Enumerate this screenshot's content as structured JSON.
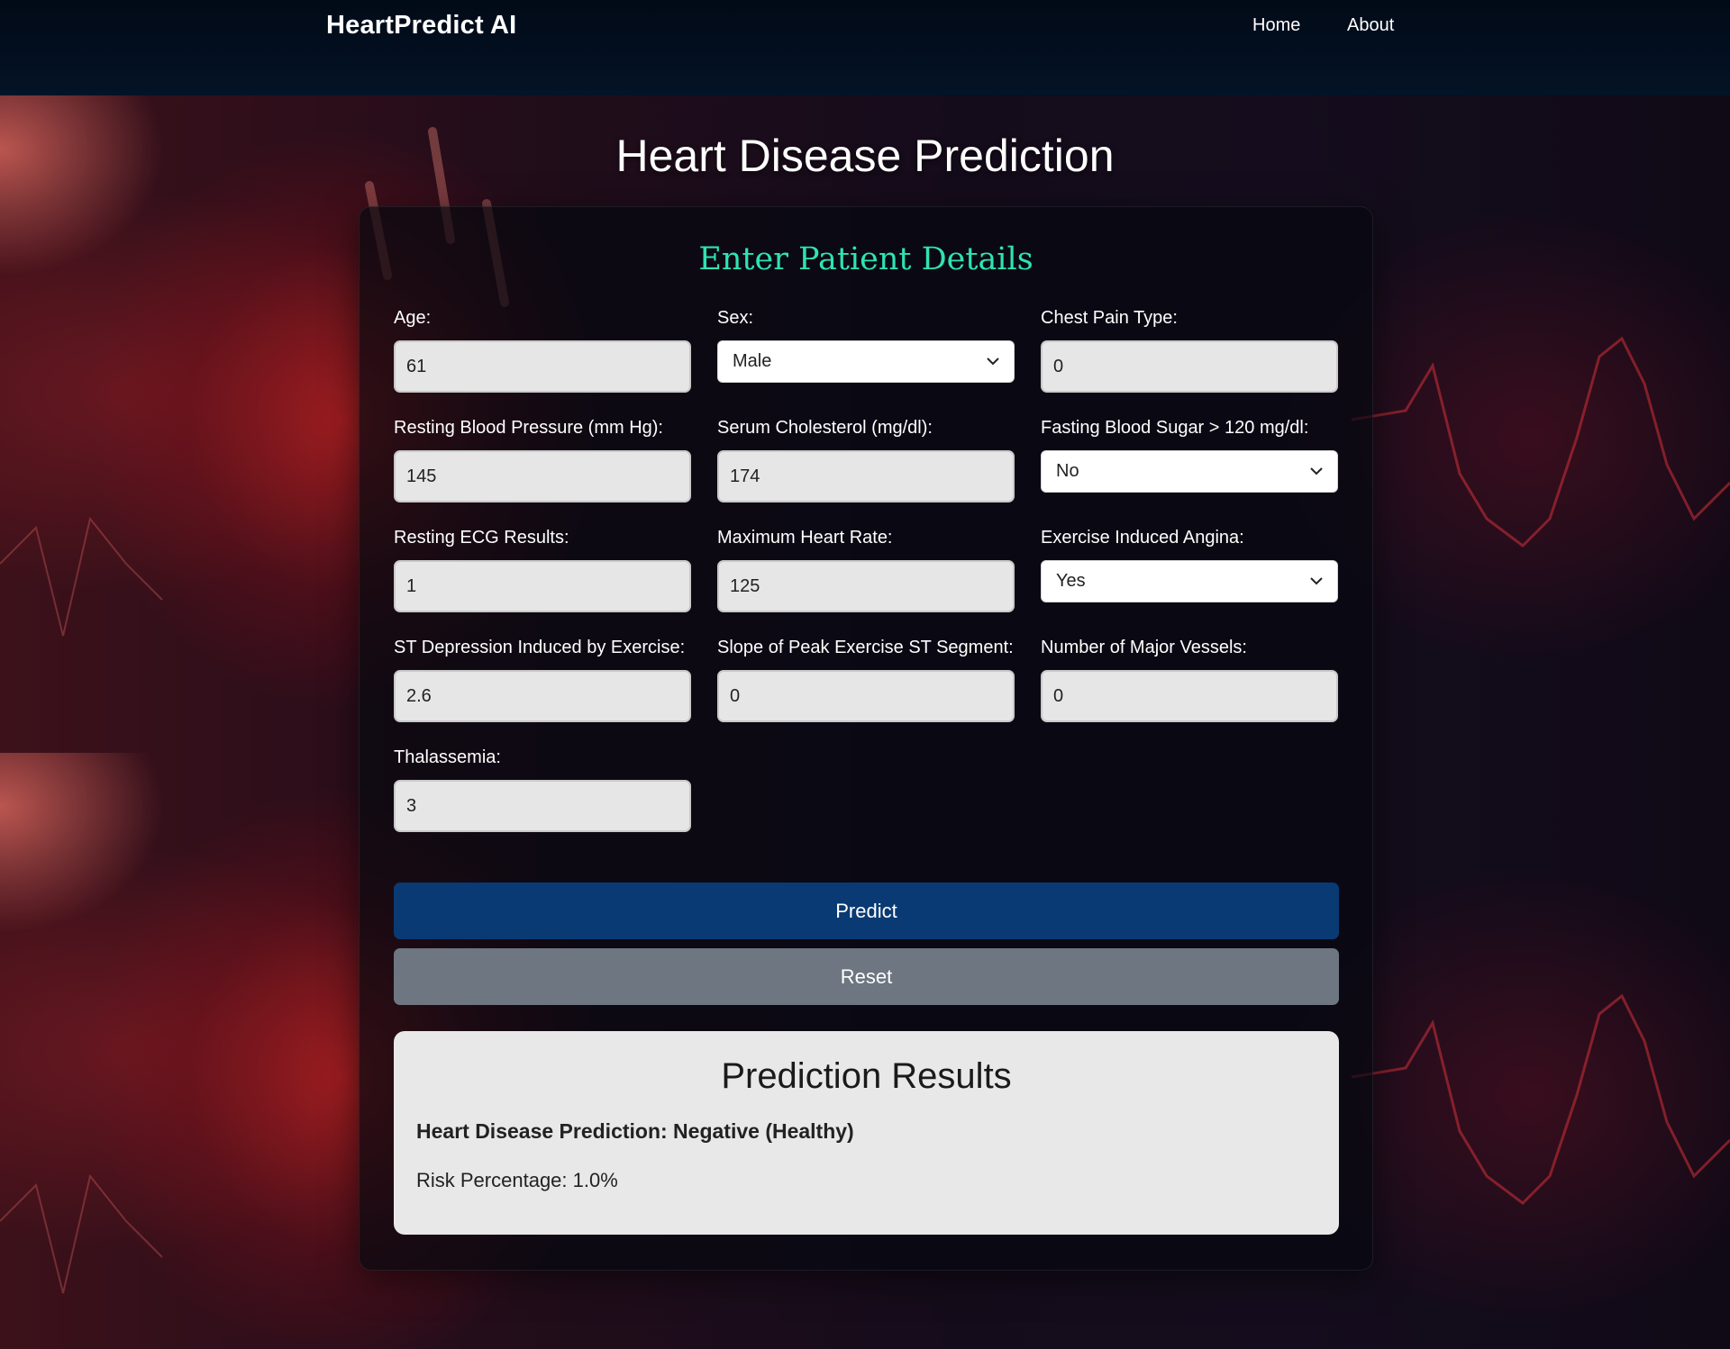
{
  "navbar": {
    "brand": "HeartPredict AI",
    "links": [
      {
        "label": "Home"
      },
      {
        "label": "About"
      }
    ]
  },
  "page": {
    "title": "Heart Disease Prediction"
  },
  "form": {
    "title": "Enter Patient Details",
    "fields": {
      "age": {
        "label": "Age:",
        "value": "61"
      },
      "sex": {
        "label": "Sex:",
        "value": "Male"
      },
      "chest_pain": {
        "label": "Chest Pain Type:",
        "value": "0"
      },
      "resting_bp": {
        "label": "Resting Blood Pressure (mm Hg):",
        "value": "145"
      },
      "cholesterol": {
        "label": "Serum Cholesterol (mg/dl):",
        "value": "174"
      },
      "fasting_bs": {
        "label": "Fasting Blood Sugar > 120 mg/dl:",
        "value": "No"
      },
      "resting_ecg": {
        "label": "Resting ECG Results:",
        "value": "1"
      },
      "max_hr": {
        "label": "Maximum Heart Rate:",
        "value": "125"
      },
      "exercise_angina": {
        "label": "Exercise Induced Angina:",
        "value": "Yes"
      },
      "st_depression": {
        "label": "ST Depression Induced by Exercise:",
        "value": "2.6"
      },
      "st_slope": {
        "label": "Slope of Peak Exercise ST Segment:",
        "value": "0"
      },
      "major_vessels": {
        "label": "Number of Major Vessels:",
        "value": "0"
      },
      "thalassemia": {
        "label": "Thalassemia:",
        "value": "3"
      }
    },
    "predict_label": "Predict",
    "reset_label": "Reset"
  },
  "results": {
    "title": "Prediction Results",
    "prediction": "Heart Disease Prediction: Negative (Healthy)",
    "risk": "Risk Percentage: 1.0%"
  },
  "colors": {
    "accent_title": "#2ee3b4",
    "predict_button": "#0a3a73",
    "reset_button": "#6d7681",
    "navbar": "#041326"
  }
}
